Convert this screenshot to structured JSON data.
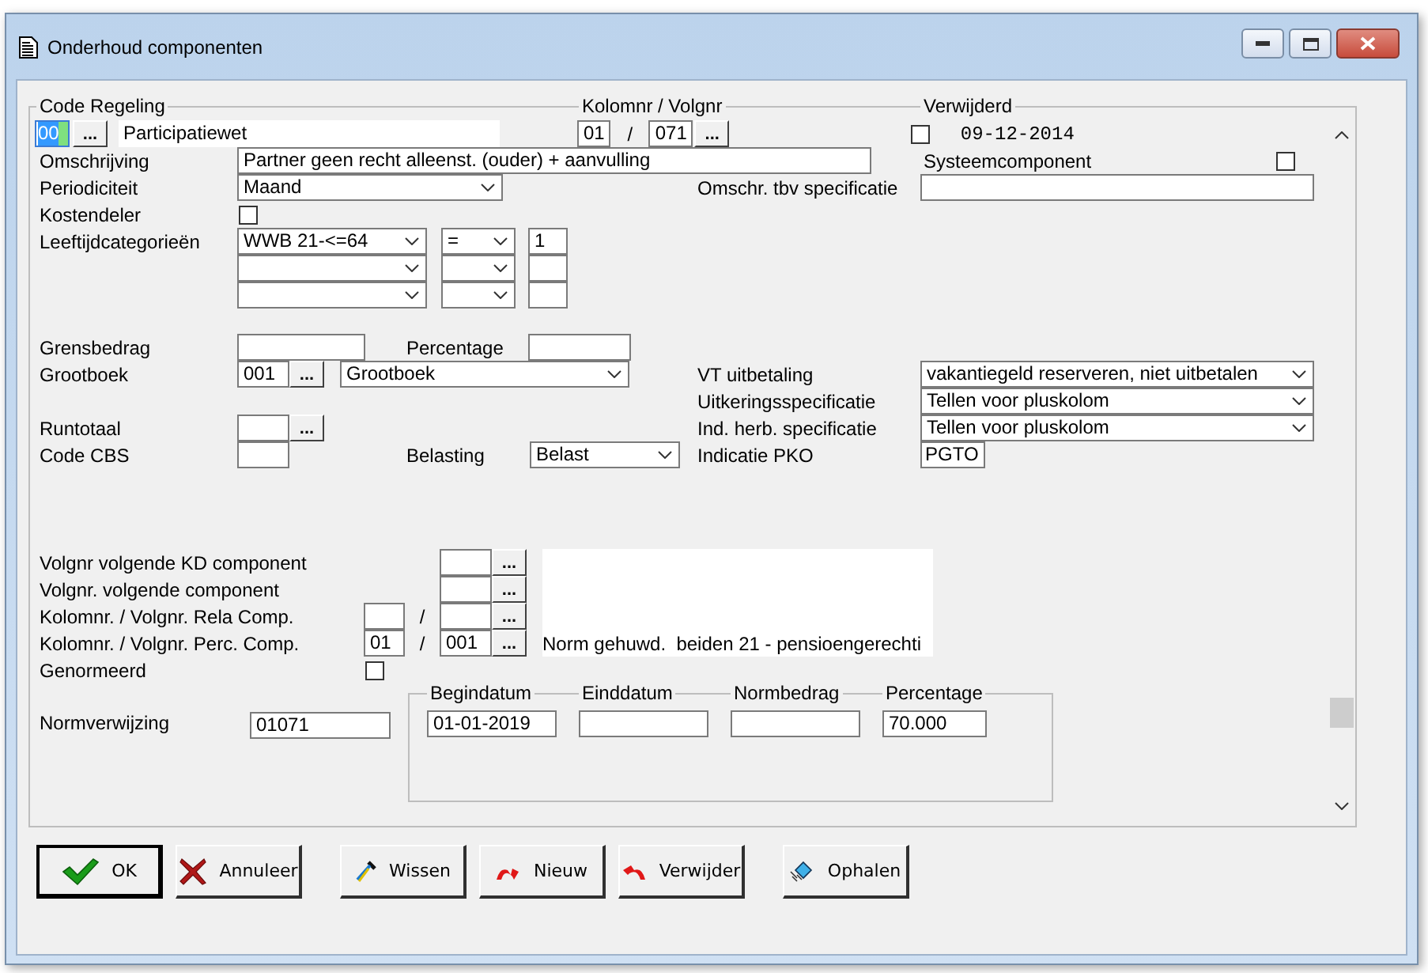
{
  "window": {
    "title": "Onderhoud componenten"
  },
  "code_regeling": {
    "legend": "Code Regeling",
    "code": "00",
    "focused": true,
    "lookup": "...",
    "name": "Participatiewet"
  },
  "kolomnr_volgnr": {
    "legend": "Kolomnr / Volgnr",
    "kolomnr": "01",
    "separator": "/",
    "volgnr": "071",
    "lookup": "..."
  },
  "verwijderd": {
    "legend": "Verwijderd",
    "checked": false,
    "date": "09-12-2014"
  },
  "omschrijving": {
    "label": "Omschrijving",
    "value": "Partner geen recht alleenst. (ouder) + aanvulling"
  },
  "systeemcomponent": {
    "label": "Systeemcomponent",
    "checked": false
  },
  "periodiciteit": {
    "label": "Periodiciteit",
    "value": "Maand"
  },
  "omschr_specificatie": {
    "label": "Omschr. tbv specificatie"
  },
  "kostendeler": {
    "label": "Kostendeler",
    "checked": false
  },
  "leeftijdcategorieen": {
    "label": "Leeftijdcategorieën",
    "rows": [
      {
        "category": "WWB 21-<=64",
        "operator": "=",
        "value": "1"
      },
      {},
      {}
    ]
  },
  "grensbedrag": {
    "label": "Grensbedrag"
  },
  "percentage": {
    "label": "Percentage"
  },
  "grootboek": {
    "label": "Grootboek",
    "code": "001",
    "lookup": "...",
    "value": "Grootboek"
  },
  "vt_uitbetaling": {
    "label": "VT uitbetaling",
    "value": "vakantiegeld reserveren, niet uitbetalen"
  },
  "uitkeringsspecificatie": {
    "label": "Uitkeringsspecificatie",
    "value": "Tellen voor pluskolom"
  },
  "runtotaal": {
    "label": "Runtotaal",
    "lookup": "..."
  },
  "ind_herb_specificatie": {
    "label": "Ind. herb. specificatie",
    "value": "Tellen voor pluskolom"
  },
  "code_cbs": {
    "label": "Code CBS"
  },
  "belasting": {
    "label": "Belasting",
    "value": "Belast"
  },
  "indicatie_pko": {
    "label": "Indicatie PKO",
    "value": "PGTO"
  },
  "volgnr_kd_component": {
    "label": "Volgnr volgende KD component",
    "lookup": "..."
  },
  "volgnr_volgende_component": {
    "label": "Volgnr. volgende component",
    "lookup": "..."
  },
  "rela_comp": {
    "label": "Kolomnr. / Volgnr. Rela Comp.",
    "separator": "/",
    "lookup": "..."
  },
  "perc_comp": {
    "label": "Kolomnr. / Volgnr. Perc. Comp.",
    "kolomnr": "01",
    "separator": "/",
    "volgnr": "001",
    "lookup": "..."
  },
  "norm_description": "Norm gehuwd.  beiden 21 - pensioengerechti",
  "genormeerd": {
    "label": "Genormeerd",
    "checked": false
  },
  "normverwijzing": {
    "label": "Normverwijzing",
    "value": "01071"
  },
  "norm_periode": {
    "columns": [
      {
        "legend": "Begindatum",
        "value": "01-01-2019"
      },
      {
        "legend": "Einddatum"
      },
      {
        "legend": "Normbedrag"
      },
      {
        "legend": "Percentage",
        "value": "70.000"
      }
    ]
  },
  "buttons": [
    {
      "label": "OK",
      "kind": "ok",
      "default": true
    },
    {
      "label": "Annuleer",
      "kind": "cancel",
      "default": false
    },
    {
      "label": "Wissen",
      "kind": "clear",
      "default": false
    },
    {
      "label": "Nieuw",
      "kind": "new",
      "default": false
    },
    {
      "label": "Verwijder",
      "kind": "delete",
      "default": false
    },
    {
      "label": "Ophalen",
      "kind": "fetch",
      "default": false
    }
  ]
}
